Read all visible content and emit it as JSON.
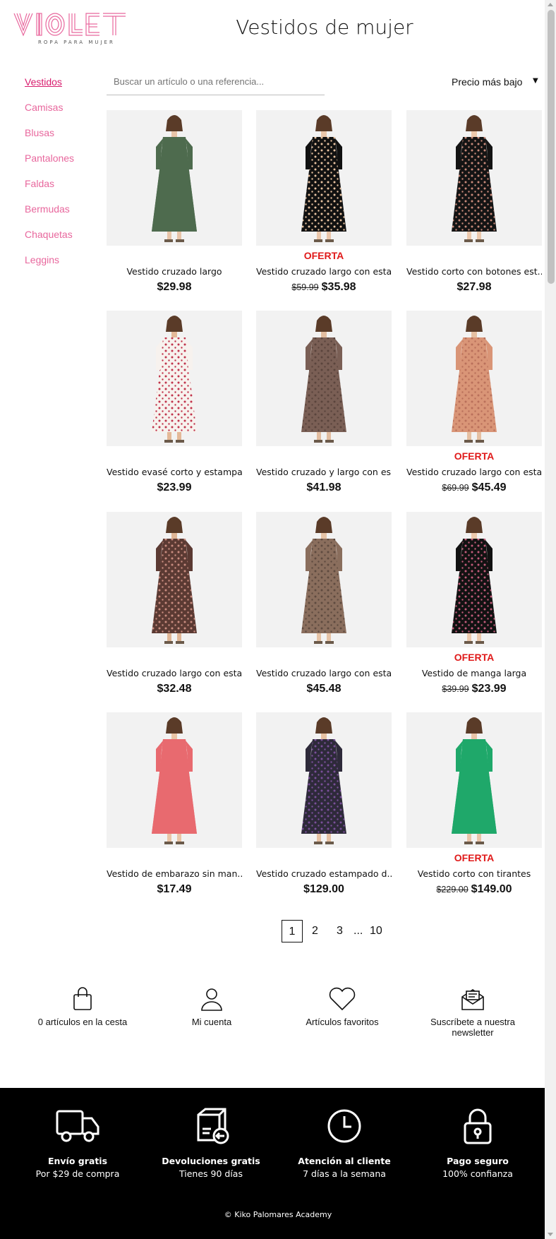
{
  "brand": {
    "logo_text": "VIOLET",
    "tagline": "ROPA PARA MUJER",
    "accent": "#e8679d"
  },
  "header": {
    "title": "Vestidos de mujer"
  },
  "sidebar": {
    "items": [
      {
        "label": "Vestidos",
        "active": true
      },
      {
        "label": "Camisas"
      },
      {
        "label": "Blusas"
      },
      {
        "label": "Pantalones"
      },
      {
        "label": "Faldas"
      },
      {
        "label": "Bermudas"
      },
      {
        "label": "Chaquetas"
      },
      {
        "label": "Leggins"
      }
    ]
  },
  "search": {
    "placeholder": "Buscar un artículo o una referencia...",
    "value": ""
  },
  "sort": {
    "selected": "Precio más bajo",
    "arrow": "▼"
  },
  "offer_label": "OFERTA",
  "products": [
    {
      "name": "Vestido cruzado largo",
      "price": "$29.98",
      "old_price": "",
      "offer": false,
      "dress": "#4e6b4e",
      "pattern": "none",
      "skin": "#e8c4a8"
    },
    {
      "name": "Vestido cruzado largo con esta...",
      "price": "$35.98",
      "old_price": "$59.99",
      "offer": true,
      "dress": "#111111",
      "pattern": "#e8c2a0",
      "skin": "#eac6aa"
    },
    {
      "name": "Vestido corto con botones est...",
      "price": "$27.98",
      "old_price": "",
      "offer": false,
      "dress": "#141414",
      "pattern": "#c98a7a",
      "skin": "#ecc9ad"
    },
    {
      "name": "Vestido evasé corto y estampa...",
      "price": "$23.99",
      "old_price": "",
      "offer": false,
      "dress": "#f7f2ee",
      "pattern": "#c0334b",
      "skin": "#e4b998"
    },
    {
      "name": "Vestido cruzado y largo con es...",
      "price": "$41.98",
      "old_price": "",
      "offer": false,
      "dress": "#7a5f55",
      "pattern": "#5a443c",
      "skin": "#e2bda0"
    },
    {
      "name": "Vestido cruzado largo con esta...",
      "price": "$45.49",
      "old_price": "$69.99",
      "offer": true,
      "dress": "#d99577",
      "pattern": "#b9705a",
      "skin": "#e6c0a2"
    },
    {
      "name": "Vestido cruzado largo con esta...",
      "price": "$32.48",
      "old_price": "",
      "offer": false,
      "dress": "#5b3a33",
      "pattern": "#c98d80",
      "skin": "#e0b696"
    },
    {
      "name": "Vestido cruzado largo con esta...",
      "price": "$45.48",
      "old_price": "",
      "offer": false,
      "dress": "#8a6e5d",
      "pattern": "#5e4a3f",
      "skin": "#e6c3a6"
    },
    {
      "name": "Vestido de manga larga",
      "price": "$23.99",
      "old_price": "$39.99",
      "offer": true,
      "dress": "#121212",
      "pattern": "#c25b7a",
      "skin": "#ecc9ad"
    },
    {
      "name": "Vestido de embarazo sin man...",
      "price": "$17.49",
      "old_price": "",
      "offer": false,
      "dress": "#e86a6f",
      "pattern": "none",
      "skin": "#eac5a6"
    },
    {
      "name": "Vestido cruzado estampado d...",
      "price": "$129.00",
      "old_price": "",
      "offer": false,
      "dress": "#2e2a3a",
      "pattern": "#7a4f9a",
      "skin": "#e6c1a3"
    },
    {
      "name": "Vestido corto con tirantes",
      "price": "$149.00",
      "old_price": "$229.00",
      "offer": true,
      "dress": "#1fa86a",
      "pattern": "none",
      "skin": "#e8c4a8"
    }
  ],
  "pagination": {
    "pages": [
      "1",
      "2",
      "3"
    ],
    "ellipsis": "...",
    "last": "10",
    "current": "1"
  },
  "utilities": [
    {
      "icon": "shopping-bag-icon",
      "label": "0 artículos en la cesta"
    },
    {
      "icon": "user-icon",
      "label": "Mi cuenta"
    },
    {
      "icon": "heart-icon",
      "label": "Artículos favoritos"
    },
    {
      "icon": "envelope-icon",
      "label": "Suscríbete a nuestra newsletter"
    }
  ],
  "footer": {
    "features": [
      {
        "icon": "truck-icon",
        "title": "Envío gratis",
        "subtitle": "Por $29 de compra"
      },
      {
        "icon": "return-box-icon",
        "title": "Devoluciones gratis",
        "subtitle": "Tienes 90 días"
      },
      {
        "icon": "clock-icon",
        "title": "Atención al cliente",
        "subtitle": "7 días a la semana"
      },
      {
        "icon": "padlock-icon",
        "title": "Pago seguro",
        "subtitle": "100% confianza"
      }
    ],
    "copyright": "© Kiko Palomares Academy"
  }
}
